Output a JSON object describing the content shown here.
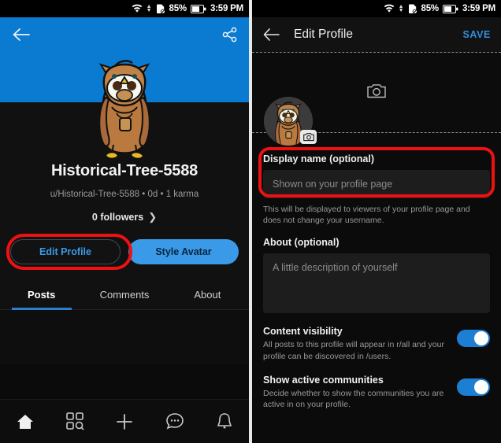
{
  "status_bar": {
    "wifi_icon": "wifi-icon",
    "data_arrows_icon": "data-transfer-icon",
    "sd_card_icon": "sd-card-off-icon",
    "battery_percent": "85%",
    "battery_icon": "battery-icon",
    "time": "3:59 PM"
  },
  "left_screen": {
    "banner": {
      "color": "#0b7ad1",
      "back_icon": "back-arrow-icon",
      "share_icon": "share-icon",
      "avatar_icon": "avatar-owl-illustration"
    },
    "profile": {
      "username": "Historical-Tree-5588",
      "meta": "u/Historical-Tree-5588 • 0d • 1 karma",
      "followers": "0 followers",
      "followers_chevron_icon": "chevron-right-icon"
    },
    "buttons": {
      "edit_profile": "Edit Profile",
      "style_avatar": "Style Avatar",
      "edit_profile_highlight_color": "#ee1111",
      "accent_color": "#3b9ae8"
    },
    "tabs": [
      {
        "label": "Posts",
        "active": true
      },
      {
        "label": "Comments",
        "active": false
      },
      {
        "label": "About",
        "active": false
      }
    ],
    "bottom_nav": [
      {
        "name": "home-icon",
        "active": true
      },
      {
        "name": "discover-icon",
        "active": false
      },
      {
        "name": "create-post-icon",
        "active": false
      },
      {
        "name": "chat-icon",
        "active": false
      },
      {
        "name": "notifications-bell-icon",
        "active": false
      }
    ]
  },
  "right_screen": {
    "header": {
      "back_icon": "back-arrow-icon",
      "title": "Edit Profile",
      "save_label": "SAVE",
      "save_color": "#2f8fe0"
    },
    "banner_edit": {
      "camera_icon": "camera-icon",
      "avatar_icon": "avatar-owl-illustration",
      "avatar_camera_badge_icon": "camera-badge-icon"
    },
    "display_name": {
      "label": "Display name (optional)",
      "placeholder": "Shown on your profile page",
      "value": "",
      "hint": "This will be displayed to viewers of your profile page and does not change your username.",
      "highlight_color": "#ee1111"
    },
    "about": {
      "label": "About (optional)",
      "placeholder": "A little description of yourself",
      "value": ""
    },
    "settings": [
      {
        "title": "Content visibility",
        "desc": "All posts to this profile will appear in r/all and your profile can be discovered in /users.",
        "enabled": true
      },
      {
        "title": "Show active communities",
        "desc": "Decide whether to show the communities you are active in on your profile.",
        "enabled": true
      }
    ]
  }
}
